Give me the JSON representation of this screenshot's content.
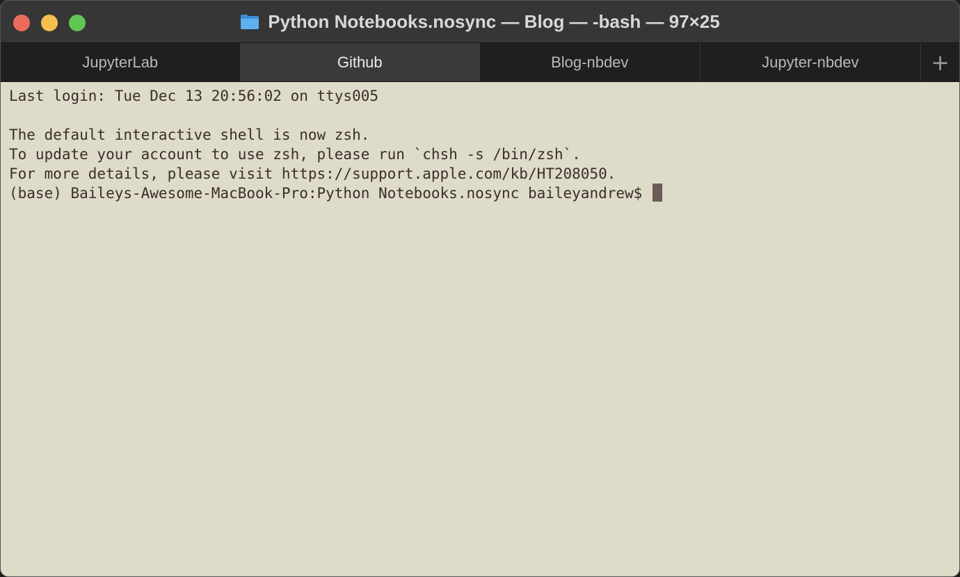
{
  "window": {
    "title": "Python Notebooks.nosync — Blog — -bash — 97×25"
  },
  "tabs": [
    {
      "label": "JupyterLab",
      "active": false
    },
    {
      "label": "Github",
      "active": true
    },
    {
      "label": "Blog-nbdev",
      "active": false
    },
    {
      "label": "Jupyter-nbdev",
      "active": false
    }
  ],
  "tab_add_label": "+",
  "terminal": {
    "lines": [
      "Last login: Tue Dec 13 20:56:02 on ttys005",
      "",
      "The default interactive shell is now zsh.",
      "To update your account to use zsh, please run `chsh -s /bin/zsh`.",
      "For more details, please visit https://support.apple.com/kb/HT208050."
    ],
    "prompt": "(base) Baileys-Awesome-MacBook-Pro:Python Notebooks.nosync baileyandrew$ "
  },
  "colors": {
    "terminal_bg": "#dedbc8",
    "terminal_fg": "#3a2e2b",
    "close": "#ed6a5e",
    "minimize": "#f5bf4f",
    "maximize": "#61c554",
    "folder": "#4aa3ea"
  },
  "icons": [
    "folder-icon",
    "close-button",
    "minimize-button",
    "maximize-button",
    "plus-icon"
  ]
}
